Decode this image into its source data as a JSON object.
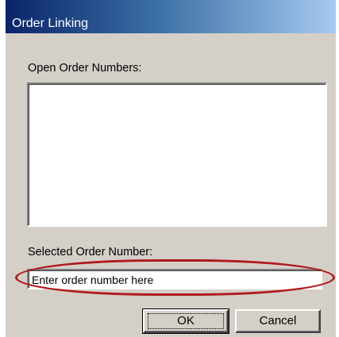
{
  "window": {
    "title": "Order Linking"
  },
  "open_orders": {
    "label": "Open Order Numbers:",
    "items": []
  },
  "selected_order": {
    "label": "Selected Order Number:",
    "value": "Enter order number here"
  },
  "buttons": {
    "ok_label": "OK",
    "cancel_label": "Cancel"
  },
  "colors": {
    "dialog_face": "#d4d0c8",
    "titlebar_start": "#0a246a",
    "titlebar_end": "#a6caf0",
    "highlight_ellipse": "#b0191e"
  }
}
